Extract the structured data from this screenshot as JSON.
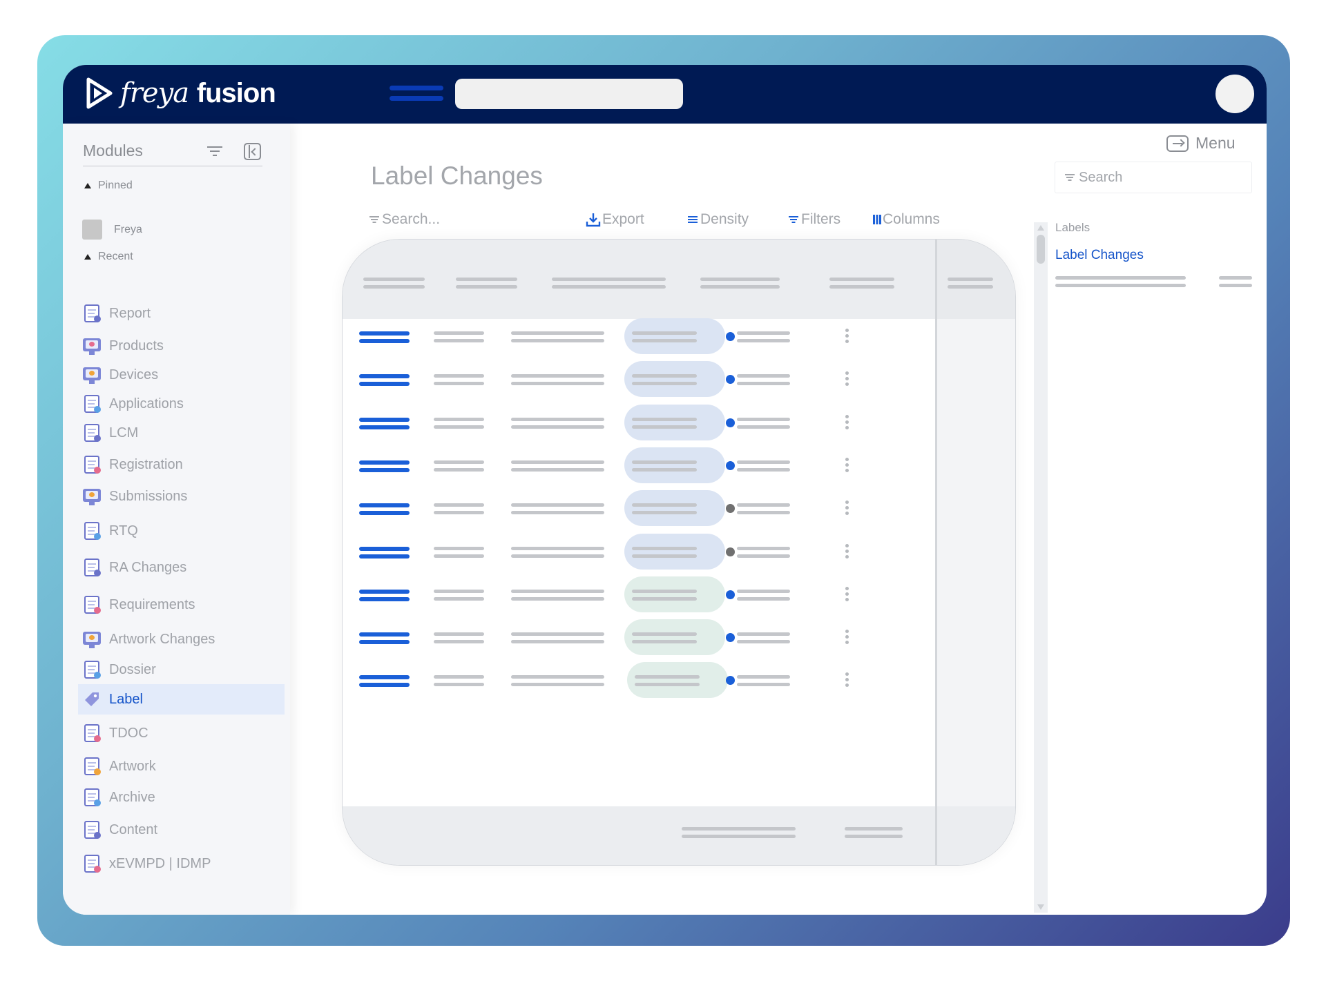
{
  "app": {
    "name": "freya",
    "name_bold": "fusion"
  },
  "sidebar": {
    "title": "Modules",
    "pinned_label": "Pinned",
    "pinned_items": [
      "Freya"
    ],
    "recent_label": "Recent",
    "items": [
      {
        "label": "Report",
        "icon": "report-icon"
      },
      {
        "label": "Products",
        "icon": "products-icon"
      },
      {
        "label": "Devices",
        "icon": "devices-icon"
      },
      {
        "label": "Applications",
        "icon": "applications-icon"
      },
      {
        "label": "LCM",
        "icon": "lcm-icon"
      },
      {
        "label": "Registration",
        "icon": "registration-icon"
      },
      {
        "label": "Submissions",
        "icon": "submissions-icon"
      },
      {
        "label": "RTQ",
        "icon": "rtq-icon"
      },
      {
        "label": "RA Changes",
        "icon": "ra-changes-icon"
      },
      {
        "label": "Requirements",
        "icon": "requirements-icon"
      },
      {
        "label": "Artwork Changes",
        "icon": "artwork-changes-icon"
      },
      {
        "label": "Dossier",
        "icon": "dossier-icon"
      },
      {
        "label": "Label",
        "icon": "label-tag-icon",
        "active": true
      },
      {
        "label": "TDOC",
        "icon": "tdoc-icon"
      },
      {
        "label": "Artwork",
        "icon": "artwork-icon"
      },
      {
        "label": "Archive",
        "icon": "archive-icon"
      },
      {
        "label": "Content",
        "icon": "content-icon"
      },
      {
        "label": "xEVMPD | IDMP",
        "icon": "xevmpd-icon"
      }
    ]
  },
  "header": {
    "menu_label": "Menu"
  },
  "main": {
    "title": "Label Changes",
    "search_placeholder": "Search...",
    "toolbar": {
      "export": "Export",
      "density": "Density",
      "filters": "Filters",
      "columns": "Columns"
    },
    "rows": [
      {
        "pill": "blue",
        "dot": "blue"
      },
      {
        "pill": "blue",
        "dot": "blue"
      },
      {
        "pill": "blue",
        "dot": "blue"
      },
      {
        "pill": "blue",
        "dot": "blue"
      },
      {
        "pill": "blue",
        "dot": "gray"
      },
      {
        "pill": "blue",
        "dot": "gray"
      },
      {
        "pill": "green",
        "dot": "blue"
      },
      {
        "pill": "green",
        "dot": "blue"
      },
      {
        "pill": "green",
        "dot": "blue"
      }
    ]
  },
  "right_panel": {
    "search_placeholder": "Search",
    "section_label": "Labels",
    "items": [
      "Label Changes"
    ]
  },
  "colors": {
    "topbar": "#001a54",
    "accent_blue": "#1a5fd8",
    "pill_blue": "#dbe4f3",
    "pill_green": "#e1eee9",
    "dot_gray": "#707070"
  }
}
